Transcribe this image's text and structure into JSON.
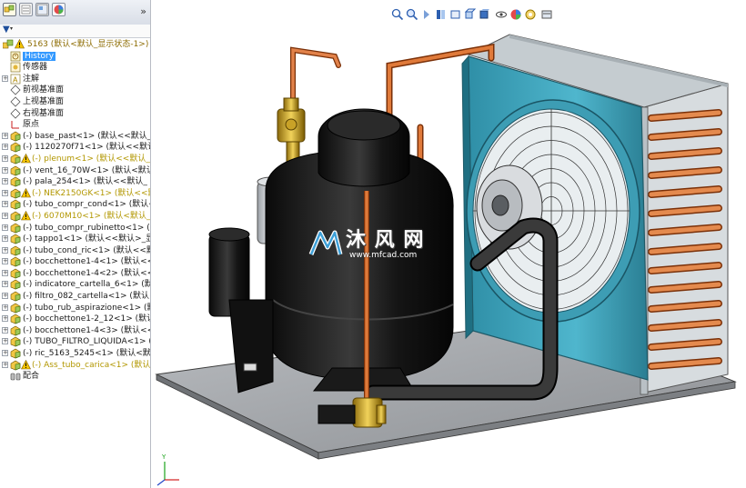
{
  "feature_tree": {
    "root": "5163  (默认<默认_显示状态-1>)",
    "items": [
      {
        "label": "History",
        "icon": "history-icon",
        "expand": false,
        "selected": true
      },
      {
        "label": "传感器",
        "icon": "sensor-icon",
        "expand": false
      },
      {
        "label": "注解",
        "icon": "annotation-icon",
        "expand": true
      },
      {
        "label": "前视基准面",
        "icon": "plane-icon",
        "expand": false
      },
      {
        "label": "上视基准面",
        "icon": "plane-icon",
        "expand": false
      },
      {
        "label": "右视基准面",
        "icon": "plane-icon",
        "expand": false
      },
      {
        "label": "原点",
        "icon": "origin-icon",
        "expand": false
      },
      {
        "label": "(-) base_past<1> (默认<<默认_",
        "icon": "part-icon",
        "expand": true
      },
      {
        "label": "(-) 1120270f71<1> (默认<<默认_",
        "icon": "part-icon",
        "expand": true
      },
      {
        "label": "(-) plenum<1> (默认<<默认_",
        "icon": "part-icon",
        "expand": true,
        "warning": true,
        "yellow": true
      },
      {
        "label": "(-) vent_16_70W<1> (默认<默认",
        "icon": "part-icon",
        "expand": true
      },
      {
        "label": "(-) pala_254<1> (默认<<默认_",
        "icon": "part-icon",
        "expand": true
      },
      {
        "label": "(-) NEK2150GK<1> (默认<<默",
        "icon": "part-icon",
        "expand": true,
        "warning": true,
        "yellow": true
      },
      {
        "label": "(-) tubo_compr_cond<1> (默认<",
        "icon": "part-icon",
        "expand": true
      },
      {
        "label": "(-) 6070M10<1> (默认<默认_",
        "icon": "part-icon",
        "expand": true,
        "warning": true,
        "yellow": true
      },
      {
        "label": "(-) tubo_compr_rubinetto<1> (默",
        "icon": "part-icon",
        "expand": true
      },
      {
        "label": "(-) tappo1<1> (默认<<默认>_显",
        "icon": "part-icon",
        "expand": true
      },
      {
        "label": "(-) tubo_cond_ric<1> (默认<<默",
        "icon": "part-icon",
        "expand": true
      },
      {
        "label": "(-) bocchettone1-4<1> (默认<<",
        "icon": "part-icon",
        "expand": true
      },
      {
        "label": "(-) bocchettone1-4<2> (默认<<",
        "icon": "part-icon",
        "expand": true
      },
      {
        "label": "(-) indicatore_cartella_6<1> (默",
        "icon": "part-icon",
        "expand": true
      },
      {
        "label": "(-) filtro_082_cartella<1> (默认<",
        "icon": "part-icon",
        "expand": true
      },
      {
        "label": "(-) tubo_rub_aspirazione<1> (默",
        "icon": "part-icon",
        "expand": true
      },
      {
        "label": "(-) bocchettone1-2_12<1> (默认",
        "icon": "part-icon",
        "expand": true
      },
      {
        "label": "(-) bocchettone1-4<3> (默认<<",
        "icon": "part-icon",
        "expand": true
      },
      {
        "label": "(-) TUBO_FILTRO_LIQUIDA<1> (",
        "icon": "part-icon",
        "expand": true
      },
      {
        "label": "(-) ric_5163_5245<1> (默认<默认",
        "icon": "part-icon",
        "expand": true
      },
      {
        "label": "(-) Ass_tubo_carica<1> (默认<",
        "icon": "part-icon",
        "expand": true,
        "warning": true,
        "yellow": true
      },
      {
        "label": "配合",
        "icon": "mates-icon",
        "expand": false
      }
    ]
  },
  "watermark": {
    "brand": "沐 风 网",
    "url": "www.mfcad.com"
  },
  "colors": {
    "accent": "#3399ff",
    "warning": "#f5c400",
    "copper": "#c8642c",
    "condenser": "#3aa0b8"
  }
}
